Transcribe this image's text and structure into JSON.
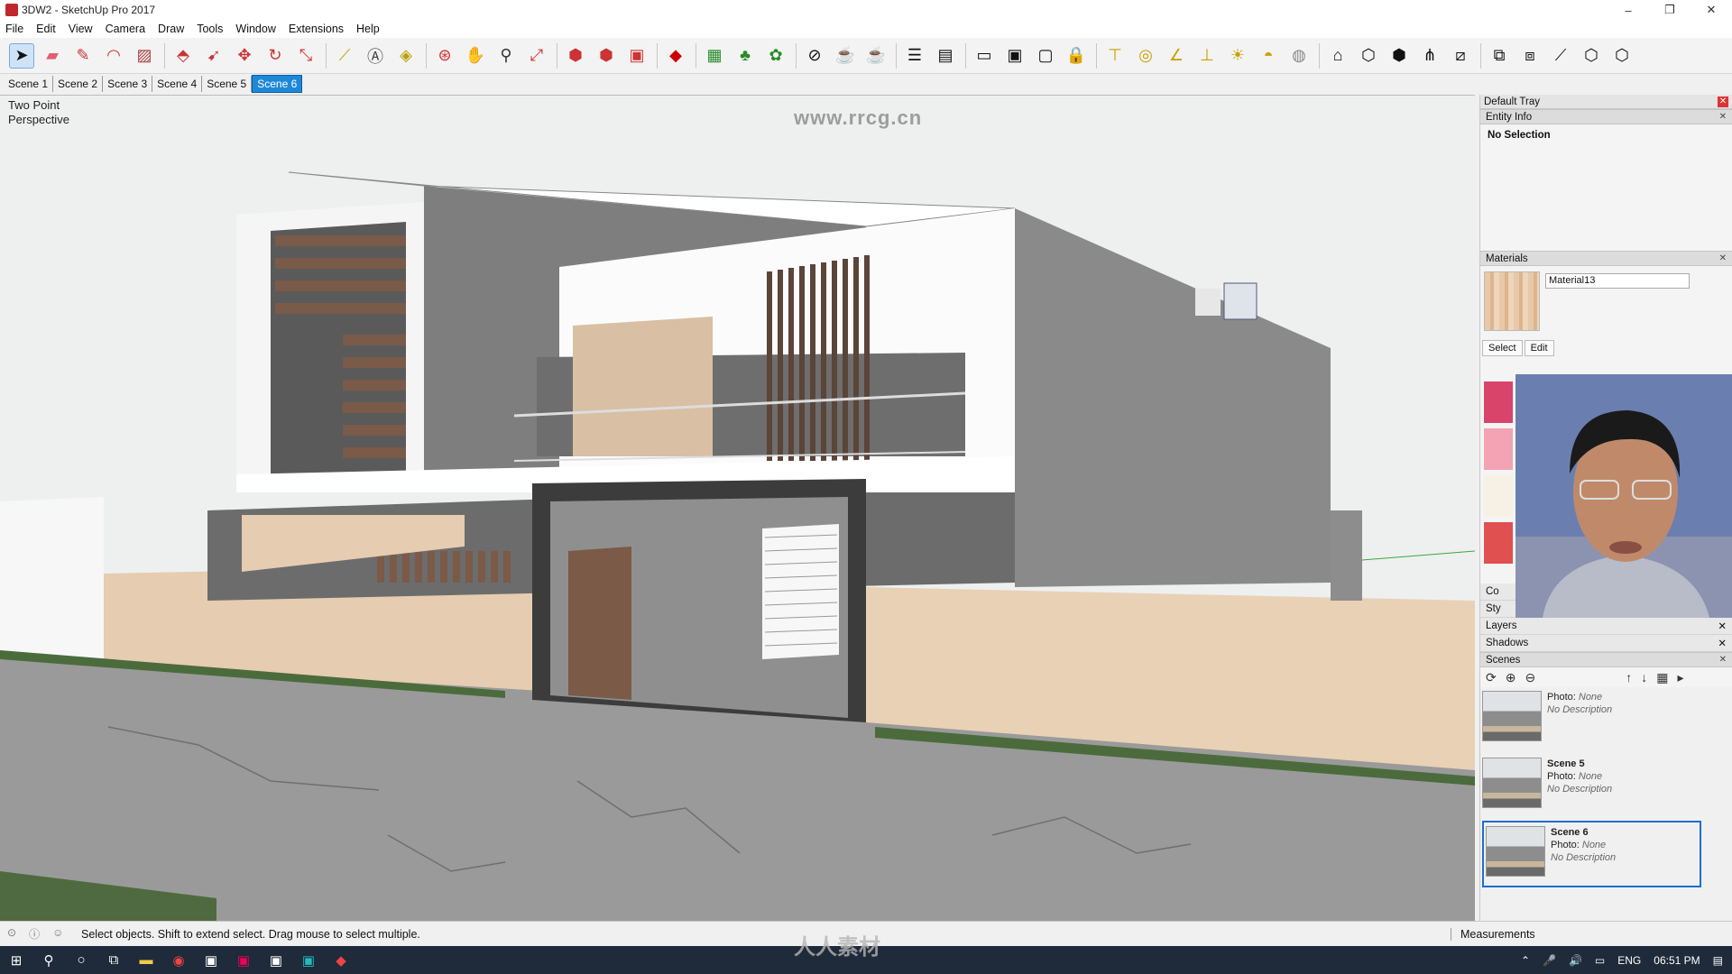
{
  "window": {
    "title": "3DW2 - SketchUp Pro 2017",
    "controls": {
      "minimize": "–",
      "restore": "❐",
      "close": "✕"
    }
  },
  "menu": [
    "File",
    "Edit",
    "View",
    "Camera",
    "Draw",
    "Tools",
    "Window",
    "Extensions",
    "Help"
  ],
  "toolbar_icons": [
    "select-icon",
    "eraser-icon",
    "pencil-icon",
    "dropdown-icon",
    "arc-icon",
    "dropdown-icon",
    "rectangle-icon",
    "dropdown-icon",
    "push-pull-icon",
    "follow-me-icon",
    "move-icon",
    "rotate-icon",
    "scale-icon",
    "tape-measure-icon",
    "text-icon",
    "paint-bucket-icon",
    "orbit-icon",
    "pan-icon",
    "zoom-icon",
    "zoom-extents-icon",
    "warehouse-icon",
    "extension-warehouse-icon",
    "layout-icon",
    "ruby-icon",
    "sandbox-icon",
    "tree-icon",
    "bush-icon",
    "circle-slash-icon",
    "teapot-icon",
    "teapot-hand-icon",
    "section-plane-icon",
    "section-cut-icon",
    "window-icon",
    "window2-icon",
    "window3-icon",
    "lock-icon",
    "stamp-icon",
    "circle-icon",
    "protractor-icon",
    "axes-icon",
    "sun-icon",
    "dome-icon",
    "sphere-icon",
    "camera-icon",
    "box-icon",
    "box2-icon",
    "grass-icon",
    "pipe-icon",
    "group-icon",
    "component-icon",
    "line-icon",
    "iso-icon",
    "iso2-icon"
  ],
  "scene_tabs": [
    "Scene 1",
    "Scene 2",
    "Scene 3",
    "Scene 4",
    "Scene 5",
    "Scene 6"
  ],
  "selected_scene_tab": "Scene 6",
  "viewport": {
    "camera_label_line1": "Two Point",
    "camera_label_line2": "Perspective",
    "watermark_url": "www.rrcg.cn",
    "watermark_text": "RRCG"
  },
  "tray": {
    "title": "Default Tray",
    "entity_info": {
      "label": "Entity Info",
      "selection": "No Selection"
    },
    "materials": {
      "label": "Materials",
      "current": "Material13",
      "tabs": [
        "Select",
        "Edit"
      ],
      "colors": [
        "#d9446b",
        "#f3a3b3",
        "#f6f1e4",
        "#e15050"
      ]
    },
    "components_label": "Co",
    "styles_label": "Sty",
    "layers_label": "Layers",
    "shadows_label": "Shadows",
    "scenes": {
      "label": "Scenes",
      "items": [
        {
          "name": "",
          "photo_label": "Photo:",
          "photo": "None",
          "desc": "No Description"
        },
        {
          "name": "Scene 5",
          "photo_label": "Photo:",
          "photo": "None",
          "desc": "No Description"
        },
        {
          "name": "Scene 6",
          "photo_label": "Photo:",
          "photo": "None",
          "desc": "No Description"
        }
      ]
    }
  },
  "status": {
    "message": "Select objects. Shift to extend select. Drag mouse to select multiple.",
    "measurements_label": "Measurements"
  },
  "taskbar": {
    "language": "ENG",
    "time": "06:51 PM",
    "watermark": "人人素材"
  }
}
